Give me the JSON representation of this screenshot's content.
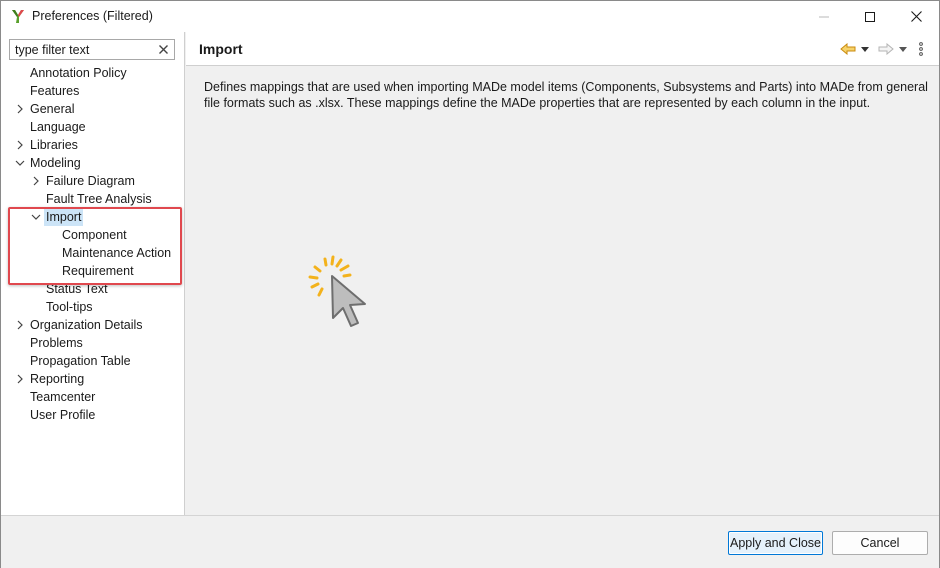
{
  "window": {
    "title": "Preferences (Filtered)"
  },
  "filter": {
    "placeholder": "type filter text",
    "value": "type filter text"
  },
  "tree": [
    {
      "label": "Annotation Policy",
      "level": 0,
      "twisty": "none"
    },
    {
      "label": "Features",
      "level": 0,
      "twisty": "none"
    },
    {
      "label": "General",
      "level": 0,
      "twisty": "collapsed"
    },
    {
      "label": "Language",
      "level": 0,
      "twisty": "none"
    },
    {
      "label": "Libraries",
      "level": 0,
      "twisty": "collapsed"
    },
    {
      "label": "Modeling",
      "level": 0,
      "twisty": "expanded"
    },
    {
      "label": "Failure Diagram",
      "level": 1,
      "twisty": "collapsed"
    },
    {
      "label": "Fault Tree Analysis",
      "level": 1,
      "twisty": "none"
    },
    {
      "label": "Import",
      "level": 1,
      "twisty": "expanded",
      "selected": true
    },
    {
      "label": "Component",
      "level": 2,
      "twisty": "none"
    },
    {
      "label": "Maintenance Action",
      "level": 2,
      "twisty": "none"
    },
    {
      "label": "Requirement",
      "level": 2,
      "twisty": "none"
    },
    {
      "label": "Status Text",
      "level": 1,
      "twisty": "none"
    },
    {
      "label": "Tool-tips",
      "level": 1,
      "twisty": "none"
    },
    {
      "label": "Organization Details",
      "level": 0,
      "twisty": "collapsed"
    },
    {
      "label": "Problems",
      "level": 0,
      "twisty": "none"
    },
    {
      "label": "Propagation Table",
      "level": 0,
      "twisty": "none"
    },
    {
      "label": "Reporting",
      "level": 0,
      "twisty": "collapsed"
    },
    {
      "label": "Teamcenter",
      "level": 0,
      "twisty": "none"
    },
    {
      "label": "User Profile",
      "level": 0,
      "twisty": "none"
    }
  ],
  "page": {
    "title": "Import",
    "description": "Defines mappings that are used when importing MADe model items (Components, Subsystems and Parts) into MADe from general file formats such as .xlsx. These mappings define the MADe properties that are represented by each column in the input."
  },
  "buttons": {
    "apply": "Apply and Close",
    "cancel": "Cancel"
  },
  "icons": {
    "app": "made-app-icon",
    "minimize": "minimize-icon",
    "maximize": "maximize-icon",
    "close": "close-icon",
    "clear": "clear-filter-icon",
    "back": "back-arrow-icon",
    "forward": "forward-arrow-icon",
    "menu": "view-menu-icon",
    "cursor": "click-cursor-icon"
  },
  "colors": {
    "highlight_box": "#e0484e",
    "selection": "#cce4f7",
    "back_arrow": "#e8a317",
    "click_burst": "#f3b21c"
  }
}
